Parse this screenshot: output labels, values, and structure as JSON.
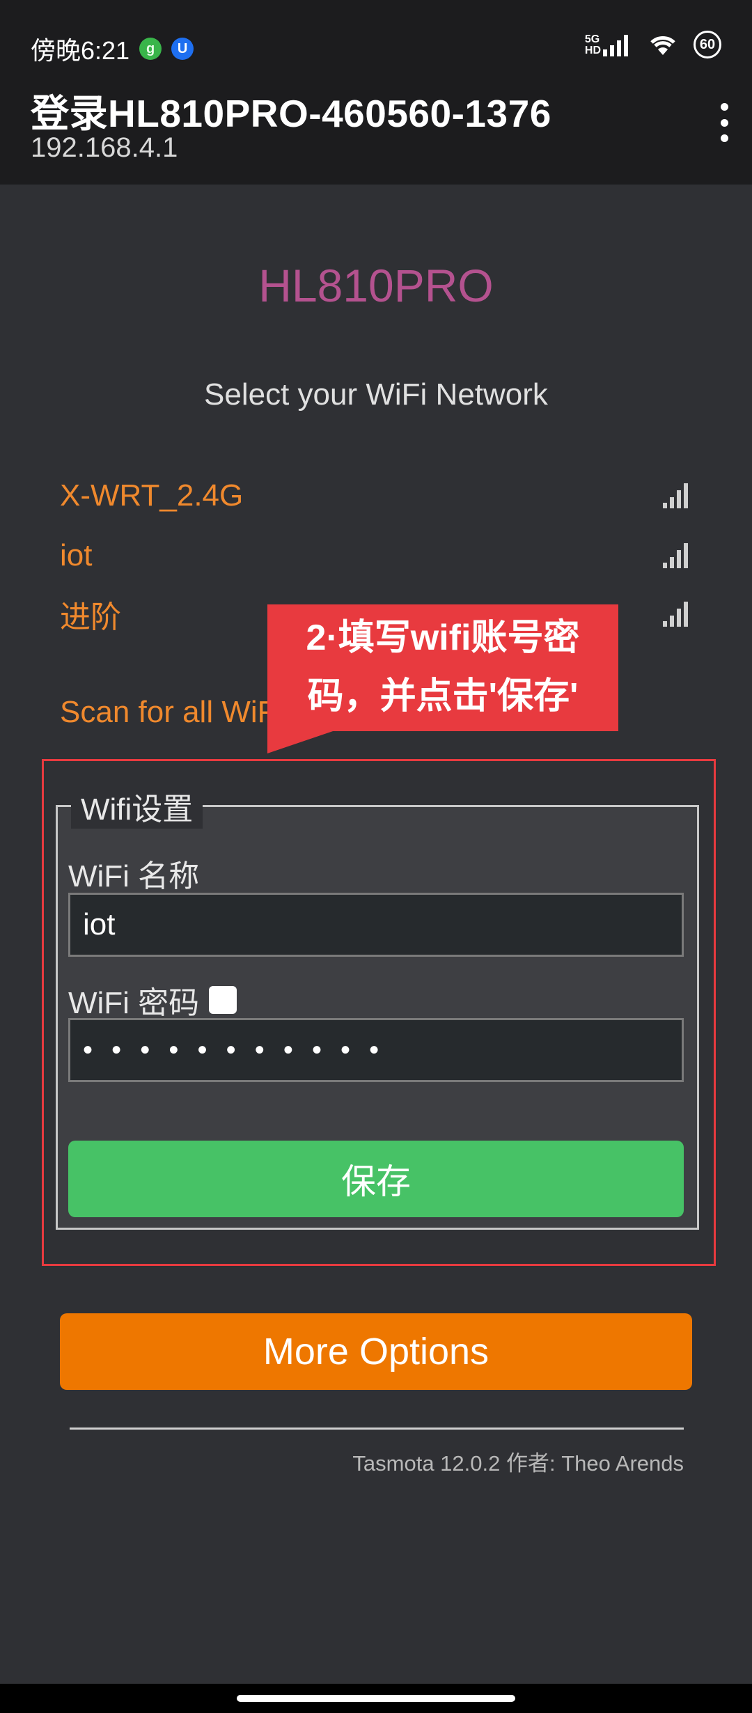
{
  "status_bar": {
    "time": "傍晚6:21",
    "icon_left_1": "g",
    "icon_left_2": "U",
    "network_label": "5G",
    "hd_label": "HD",
    "battery": "60"
  },
  "app_bar": {
    "title": "登录HL810PRO-460560-1376",
    "url": "192.168.4.1"
  },
  "page": {
    "device_name": "HL810PRO",
    "subtitle": "Select your WiFi Network",
    "networks": [
      {
        "name": "X-WRT_2.4G"
      },
      {
        "name": "iot"
      },
      {
        "name": "进阶"
      }
    ],
    "scan_link": "Scan for all WiFi Networks",
    "callout_line1": "2·填写wifi账号密",
    "callout_line2": "码，并点击'保存'",
    "fieldset_legend": "Wifi设置",
    "ssid_label": "WiFi 名称",
    "ssid_value": "iot",
    "password_label": "WiFi 密码",
    "password_dots": "• • • • • • • • • • •",
    "save_button": "保存",
    "more_button": "More Options",
    "footer": "Tasmota 12.0.2 作者: Theo Arends"
  },
  "colors": {
    "accent_pink": "#b4528f",
    "link_orange": "#f0892d",
    "save_green": "#47c266",
    "more_orange": "#ee7700",
    "callout_red": "#e83a3f"
  }
}
